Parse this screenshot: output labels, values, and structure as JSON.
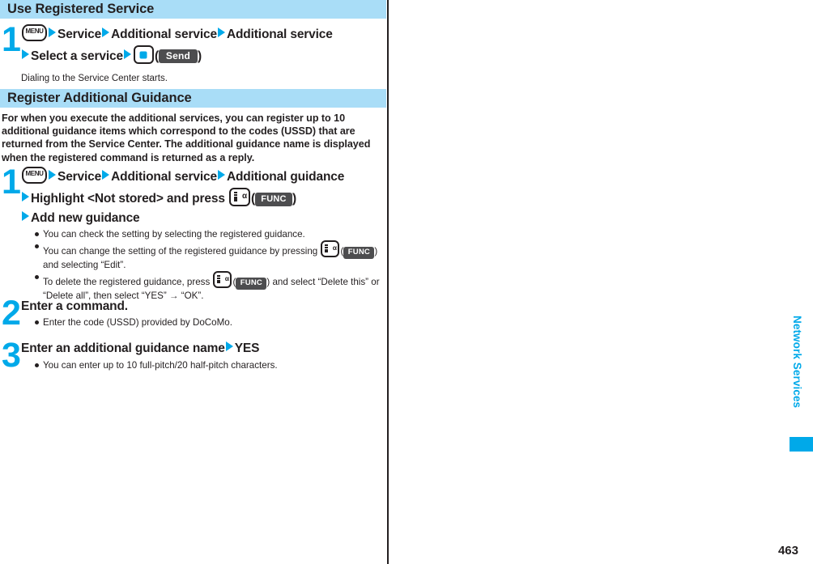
{
  "sections": [
    {
      "title": "Use Registered Service",
      "steps": [
        {
          "number": "1",
          "line1_a": "Service",
          "line1_b": "Additional service",
          "line1_c": "Additional service",
          "line2_a": "Select a service",
          "key_menu_label": "MENU",
          "softkey_send": "Send",
          "note": "Dialing to the Service Center starts."
        }
      ]
    },
    {
      "title": "Register Additional Guidance",
      "intro": "For when you execute the additional services, you can register up to 10 additional guidance items which correspond to the codes (USSD) that are returned from the Service Center. The additional guidance name is displayed when the registered command is returned as a reply.",
      "steps": [
        {
          "number": "1",
          "key_menu_label": "MENU",
          "line1_a": "Service",
          "line1_b": "Additional service",
          "line1_c": "Additional guidance",
          "line2_a": "Highlight <Not stored> and press",
          "line2_softkey": "FUNC",
          "line3_a": "Add new guidance",
          "bullets": [
            {
              "pre": "You can check the setting by selecting the registered guidance."
            },
            {
              "pre": "You can change the setting of the registered guidance by pressing",
              "softkey": "FUNC",
              "post": "",
              "cont": "and selecting “Edit”."
            },
            {
              "pre": "To delete the registered guidance, press",
              "softkey": "FUNC",
              "post": "and select “Delete this” or",
              "cont": "“Delete all”, then select “YES” → “OK”."
            }
          ]
        },
        {
          "number": "2",
          "lead": "Enter a command.",
          "bullets": [
            {
              "pre": "Enter the code (USSD) provided by DoCoMo."
            }
          ]
        },
        {
          "number": "3",
          "lead_a": "Enter an additional guidance name",
          "lead_b": "YES",
          "bullets": [
            {
              "pre": "You can enter up to 10 full-pitch/20 half-pitch characters."
            }
          ]
        }
      ]
    }
  ],
  "margin": {
    "tab_label": "Network Services",
    "page_number": "463"
  },
  "colors": {
    "accent": "#00a9e9",
    "header_bar": "#a9ddf7",
    "softkey": "#4d4d4f",
    "text": "#231f20"
  }
}
